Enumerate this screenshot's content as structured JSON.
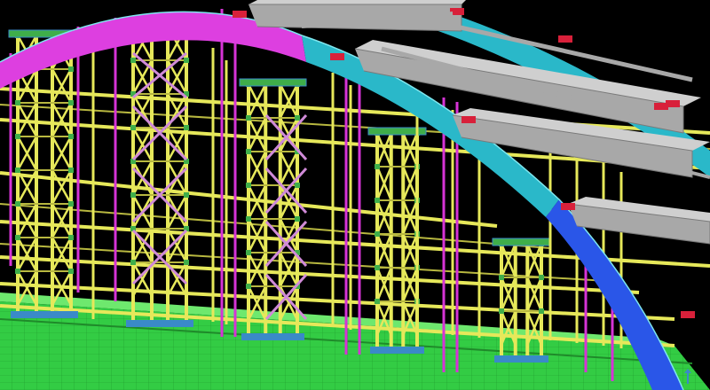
{
  "viewport": {
    "background": "#000000"
  },
  "colors": {
    "scaffold_yellow": "#e6e85a",
    "scaffold_yellow_dark": "#b8b840",
    "hanger_magenta": "#d633d6",
    "brace_pink": "#d08ad8",
    "arch_magenta": "#dd3fe0",
    "arch_cyan": "#2ab8c9",
    "arch_blue": "#2a56e8",
    "crossbeam_gray": "#a8a8a8",
    "crossbeam_gray_dark": "#7a7a7a",
    "joint_red": "#d8203a",
    "deck_green": "#33cc44",
    "deck_green_light": "#6ee86e",
    "detail_green": "#3fae4a",
    "fitting_blue": "#3a8ac8"
  },
  "scene": {
    "arch_segments": [
      "magenta",
      "cyan",
      "blue"
    ],
    "deck": "green-deck",
    "icons": {
      "axis": "axis-triad-icon"
    }
  }
}
